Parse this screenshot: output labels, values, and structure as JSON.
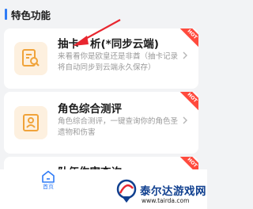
{
  "section": {
    "title": "特色功能"
  },
  "cards": [
    {
      "title": "抽卡分析(*同步云端)",
      "title_visible": "抽卡",
      "title_tail": "析(*同步云端)",
      "desc": "来看看你是欧皇还是非酋（抽卡记录将自动同步到云端永久保存）",
      "tag": "HOT",
      "icon": "document-search-icon"
    },
    {
      "title": "角色综合测评",
      "desc": "角色综合测评，一键查询你的角色圣遗物和伤害",
      "tag": "HOT",
      "icon": "character-card-icon"
    },
    {
      "title": "队伍伤害查询",
      "tag": "HOT",
      "icon": "team-damage-icon"
    }
  ],
  "bottom_nav": {
    "home_label": "首页",
    "home_icon": "home-icon"
  },
  "watermark": {
    "title": "泰尔达游戏网",
    "url": "www.tairda.com"
  },
  "colors": {
    "accent": "#2f7bf6",
    "hot": "#ff4a3d",
    "icon_bg": "#fdf0df",
    "icon_fg": "#f0a33a",
    "arrow": "#e8262f"
  }
}
